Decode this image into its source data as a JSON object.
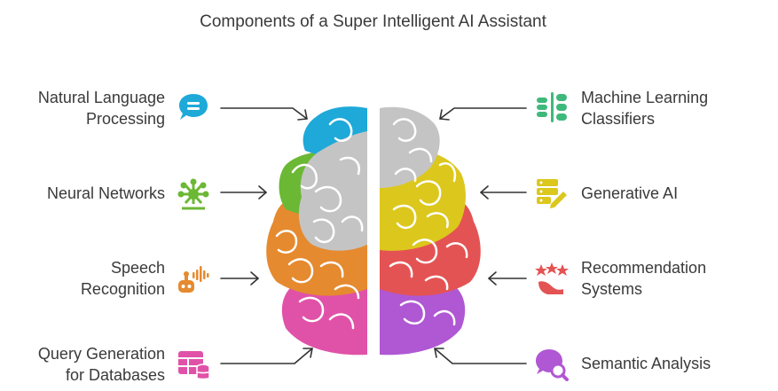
{
  "title": "Components of a Super Intelligent AI Assistant",
  "colors": {
    "nlp": "#1ea9d9",
    "neural": "#6bb834",
    "speech": "#e58a2f",
    "query": "#e052a8",
    "ml": "#3fb97b",
    "generative": "#dcc71d",
    "recommendation": "#e45353",
    "semantic": "#b057d4",
    "gray": "#c4c4c4",
    "arrow": "#333333"
  },
  "components": {
    "nlp": {
      "line1": "Natural Language",
      "line2": "Processing",
      "icon": "chat-bubble-icon"
    },
    "neural": {
      "line1": "Neural Networks",
      "icon": "network-node-icon"
    },
    "speech": {
      "line1": "Speech",
      "line2": "Recognition",
      "icon": "robot-voice-icon"
    },
    "query": {
      "line1": "Query Generation",
      "line2": "for Databases",
      "icon": "database-table-icon"
    },
    "ml": {
      "line1": "Machine Learning",
      "line2": "Classifiers",
      "icon": "classifier-icon"
    },
    "generative": {
      "line1": "Generative AI",
      "icon": "database-pencil-icon"
    },
    "recommendation": {
      "line1": "Recommendation",
      "line2": "Systems",
      "icon": "stars-hand-icon"
    },
    "semantic": {
      "line1": "Semantic Analysis",
      "icon": "chat-search-icon"
    }
  }
}
